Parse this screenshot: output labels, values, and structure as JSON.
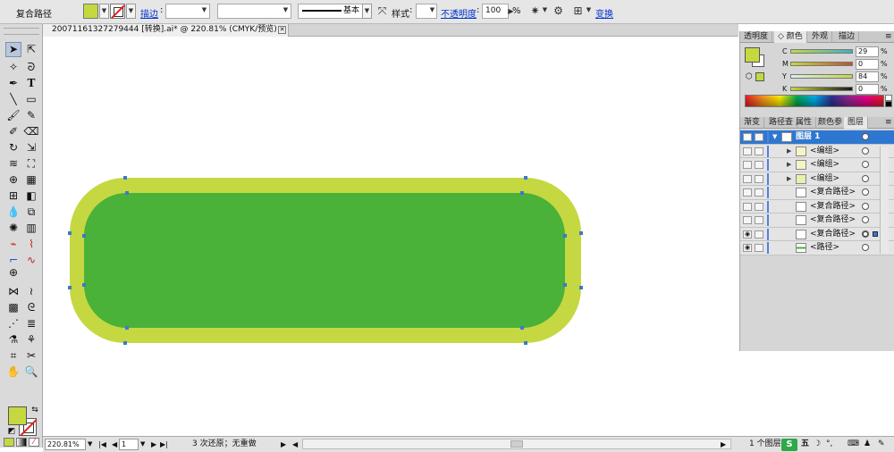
{
  "control_bar": {
    "selection_label": "复合路径",
    "fill_color": "#c5d841",
    "stroke_label": "描边",
    "stroke_weight": "",
    "brush_style": "基本",
    "style_label": "样式",
    "opacity_label": "不透明度",
    "opacity_value": "100",
    "opacity_unit": "%",
    "transform_label": "变换"
  },
  "document_tab": {
    "title": "20071161327279444 [转换].ai* @ 220.81% (CMYK/预览)",
    "close": "✕"
  },
  "artwork": {
    "outer_color": "#c5d841",
    "inner_color": "#4ab238",
    "anchor_color": "#3a78d4"
  },
  "color_panel": {
    "tabs": [
      "透明度",
      "颜色",
      "外观",
      "描边"
    ],
    "active_tab": 1,
    "sliders": [
      {
        "label": "C",
        "value": "29",
        "unit": "%"
      },
      {
        "label": "M",
        "value": "0",
        "unit": "%"
      },
      {
        "label": "Y",
        "value": "84",
        "unit": "%"
      },
      {
        "label": "K",
        "value": "0",
        "unit": "%"
      }
    ]
  },
  "layers_panel": {
    "tabs": [
      "渐变",
      "路径查",
      "属性",
      "颜色参",
      "图层"
    ],
    "active_tab": 4,
    "rows": [
      {
        "name": "图层 1",
        "selected": true,
        "expand": "▼",
        "has_eye": true
      },
      {
        "name": "<编组>",
        "selected": false,
        "expand": "▶",
        "has_eye": false
      },
      {
        "name": "<编组>",
        "selected": false,
        "expand": "▶",
        "has_eye": false
      },
      {
        "name": "<编组>",
        "selected": false,
        "expand": "▶",
        "has_eye": false
      },
      {
        "name": "<复合路径>",
        "selected": false,
        "expand": "",
        "has_eye": false
      },
      {
        "name": "<复合路径>",
        "selected": false,
        "expand": "",
        "has_eye": false
      },
      {
        "name": "<复合路径>",
        "selected": false,
        "expand": "",
        "has_eye": false
      },
      {
        "name": "<复合路径>",
        "selected": false,
        "expand": "",
        "has_eye": true
      },
      {
        "name": "<路径>",
        "selected": false,
        "expand": "",
        "has_eye": true
      }
    ],
    "layer_count": "1 个图层"
  },
  "status_bar": {
    "zoom": "220.81%",
    "page": "1",
    "undo_text": "3 次还原；无重做"
  },
  "tray": {
    "ime_logo": "S",
    "ime_mode": "五"
  }
}
